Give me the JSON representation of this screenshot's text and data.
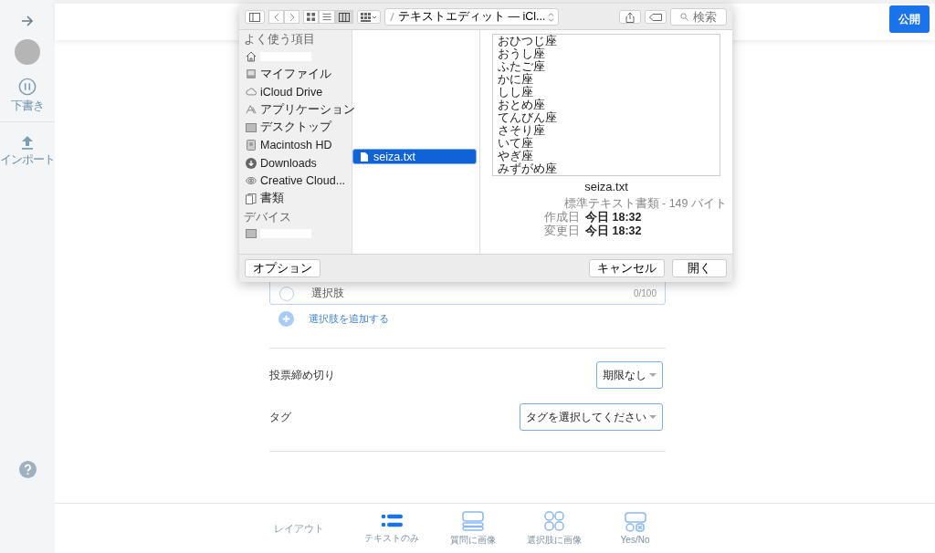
{
  "sidebar": {
    "items": [
      {
        "kind": "draft",
        "label": "下書き"
      },
      {
        "kind": "import",
        "label": "インポート"
      }
    ]
  },
  "header": {
    "publish_button": "公開"
  },
  "form": {
    "choice": {
      "placeholder": "選択肢",
      "counter": "0/100"
    },
    "add_choice": "選択肢を追加する",
    "settings": [
      {
        "label": "投票締め切り",
        "value": "期限なし"
      },
      {
        "label": "タグ",
        "value": "タグを選択してください"
      }
    ]
  },
  "layout_bar": {
    "label": "レイアウト",
    "options": [
      {
        "kind": "text",
        "label": "テキストのみ",
        "selected": true
      },
      {
        "kind": "question-image",
        "label": "質問に画像",
        "selected": false
      },
      {
        "kind": "choice-image",
        "label": "選択肢に画像",
        "selected": false
      },
      {
        "kind": "yesno",
        "label": "Yes/No",
        "selected": false
      }
    ]
  },
  "dialog": {
    "path": "テキストエディット — iCl...",
    "search_placeholder": "検索",
    "sidebar": [
      {
        "heading": "よく使う項目",
        "items": [
          {
            "kind": "home"
          },
          {
            "kind": "myfiles",
            "label": "マイファイル"
          },
          {
            "kind": "cloud",
            "label": "iCloud Drive"
          },
          {
            "kind": "apps",
            "label": "アプリケーション"
          },
          {
            "kind": "desktop",
            "label": "デスクトップ"
          },
          {
            "kind": "disk",
            "label": "Macintosh HD"
          },
          {
            "kind": "downloads",
            "label": "Downloads"
          },
          {
            "kind": "cc",
            "label": "Creative Cloud..."
          },
          {
            "kind": "docs",
            "label": "書類"
          }
        ]
      },
      {
        "heading": "デバイス",
        "items": [
          {
            "kind": "desktop"
          }
        ]
      }
    ],
    "files": [
      {
        "name": "seiza.txt",
        "selected": true
      }
    ],
    "preview": {
      "lines": [
        "おひつじ座",
        "おうし座",
        "ふたご座",
        "かに座",
        "しし座",
        "おとめ座",
        "てんびん座",
        "さそり座",
        "いて座",
        "やぎ座",
        "みずがめ座"
      ],
      "filename": "seiza.txt",
      "kind": "標準テキスト書類 - 149 バイト",
      "meta": [
        {
          "label": "作成日",
          "value": "今日 18:32"
        },
        {
          "label": "変更日",
          "value": "今日 18:32"
        }
      ]
    },
    "options_button": "オプション",
    "cancel_button": "キャンセル",
    "open_button": "開く"
  }
}
